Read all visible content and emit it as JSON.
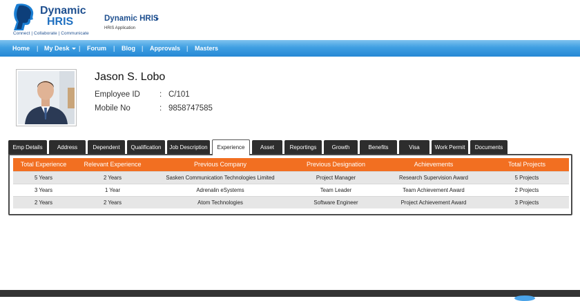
{
  "logo": {
    "title": "Dynamic",
    "subtitle": "HRIS",
    "tagline": "Connect | Collaborate | Communicate",
    "icon": "head-profile-icon"
  },
  "app": {
    "name": "Dynamic HRIS",
    "subtitle": "HRIS Application",
    "arrow_icon": "triangle-right-icon"
  },
  "nav": {
    "items": [
      "Home",
      "My Desk",
      "Forum",
      "Blog",
      "Approvals",
      "Masters"
    ],
    "separator": "|"
  },
  "employee": {
    "name": "Jason S. Lobo",
    "fields": [
      {
        "label": "Employee ID",
        "colon": ":",
        "value": "C/101"
      },
      {
        "label": "Mobile No",
        "colon": ":",
        "value": "9858747585"
      }
    ]
  },
  "tabs": {
    "items": [
      "Emp Details",
      "Address",
      "Dependent",
      "Qualification",
      "Job Description",
      "Experience",
      "Asset",
      "Reportings",
      "Growth",
      "Benefits",
      "Visa",
      "Work Permit",
      "Documents"
    ],
    "active": "Experience"
  },
  "experience_table": {
    "headers": [
      "Total Experience",
      "Relevant Experience",
      "Previous Company",
      "Previous Designation",
      "Achievements",
      "Total Projects"
    ],
    "rows": [
      [
        "5 Years",
        "2 Years",
        "Sasken Communication Technologies Limited",
        "Project Manager",
        "Research Supervision Award",
        "5 Projects"
      ],
      [
        "3 Years",
        "1 Year",
        "Adrenalin eSystems",
        "Team Leader",
        "Team Achievement Award",
        "2 Projects"
      ],
      [
        "2 Years",
        "2 Years",
        "Atom Technologies",
        "Software Engineer",
        "Project Achievement Award",
        "3 Projects"
      ]
    ]
  },
  "colors": {
    "nav_blue": "#2688d4",
    "header_orange": "#f26f21",
    "tab_dark": "#2d2d2d",
    "brand_blue": "#1e4f8f"
  }
}
